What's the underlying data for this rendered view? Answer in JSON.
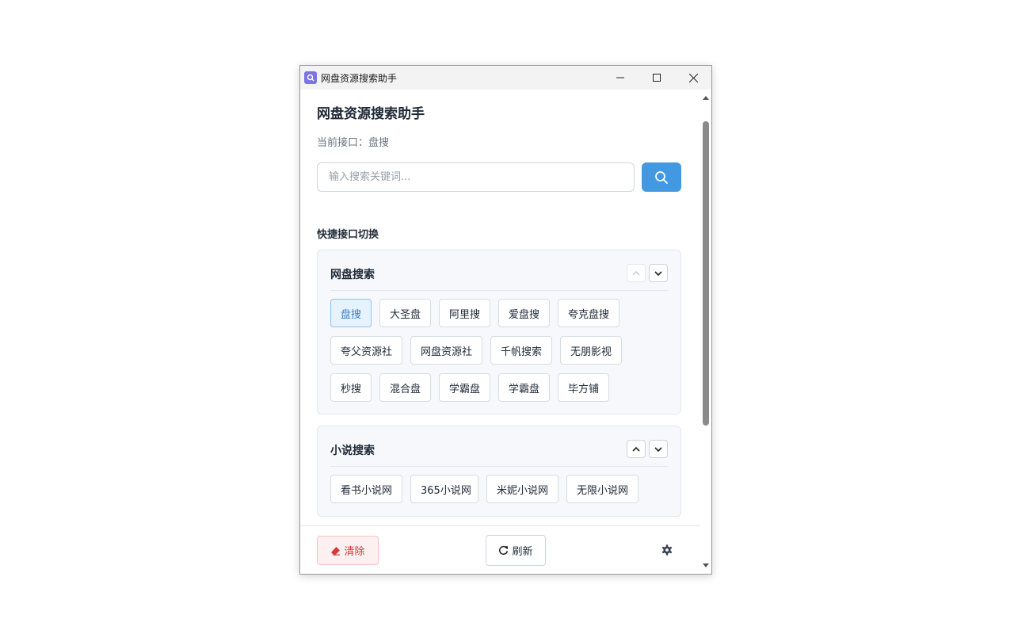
{
  "window": {
    "title": "网盘资源搜索助手"
  },
  "app": {
    "title": "网盘资源搜索助手",
    "current_api": "当前接口：盘搜"
  },
  "search": {
    "placeholder": "输入搜索关键词..."
  },
  "quick_switch": {
    "heading": "快捷接口切换",
    "groups": [
      {
        "title": "网盘搜索",
        "items": [
          "盘搜",
          "大圣盘",
          "阿里搜",
          "爱盘搜",
          "夸克盘搜",
          "夸父资源社",
          "网盘资源社",
          "千帆搜索",
          "无朋影视",
          "秒搜",
          "混合盘",
          "学霸盘",
          "学霸盘",
          "毕方铺"
        ],
        "active": "盘搜"
      },
      {
        "title": "小说搜索",
        "items": [
          "看书小说网",
          "365小说网",
          "米妮小说网",
          "无限小说网"
        ]
      }
    ]
  },
  "footer": {
    "clear_label": "清除",
    "refresh_label": "刷新"
  },
  "icons": {
    "app": "search-icon",
    "search": "search-icon",
    "clear": "eraser-icon",
    "refresh": "refresh-icon",
    "settings": "gear-icon"
  },
  "colors": {
    "accent": "#4299e1",
    "danger": "#d33a3a",
    "active_chip_text": "#3b82c4"
  }
}
